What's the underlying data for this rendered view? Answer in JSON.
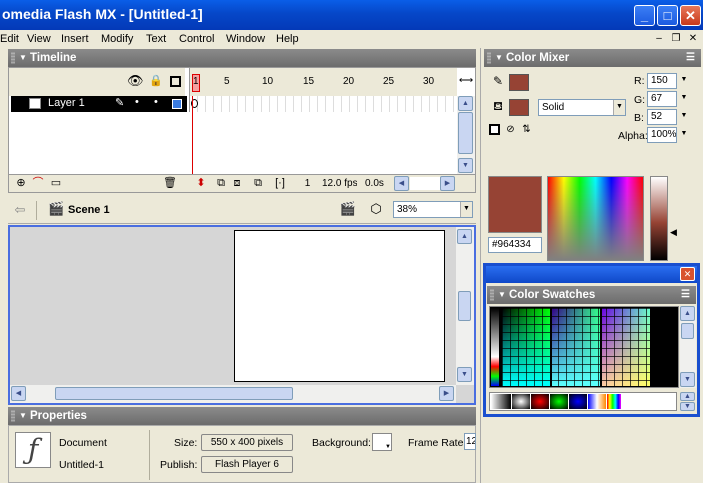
{
  "window": {
    "title": "omedia Flash MX - [Untitled-1]",
    "min": "_",
    "max": "□",
    "close": "✕"
  },
  "menu": [
    "Edit",
    "View",
    "Insert",
    "Modify",
    "Text",
    "Control",
    "Window",
    "Help"
  ],
  "mdi": {
    "min": "–",
    "restore": "❐",
    "close": "✕"
  },
  "timeline": {
    "title": "Timeline",
    "layer": "Layer 1",
    "ruler": [
      "1",
      "5",
      "10",
      "15",
      "20",
      "25",
      "30"
    ],
    "frame": "1",
    "fps": "12.0 fps",
    "time": "0.0s"
  },
  "scene": {
    "label": "Scene 1",
    "zoom": "38%"
  },
  "color_mixer": {
    "title": "Color Mixer",
    "fill_type": "Solid",
    "r_label": "R:",
    "r": "150",
    "g_label": "G:",
    "g": "67",
    "b_label": "B:",
    "b": "52",
    "alpha_label": "Alpha:",
    "alpha": "100%",
    "hex": "#964334",
    "swatch_color": "#964334"
  },
  "color_swatches": {
    "title": "Color Swatches"
  },
  "properties": {
    "title": "Properties",
    "type": "Document",
    "name": "Untitled-1",
    "size_label": "Size:",
    "size": "550 x 400 pixels",
    "publish_label": "Publish:",
    "publish": "Flash Player 6",
    "bg_label": "Background:",
    "fr_label": "Frame Rate:",
    "fr": "12"
  }
}
